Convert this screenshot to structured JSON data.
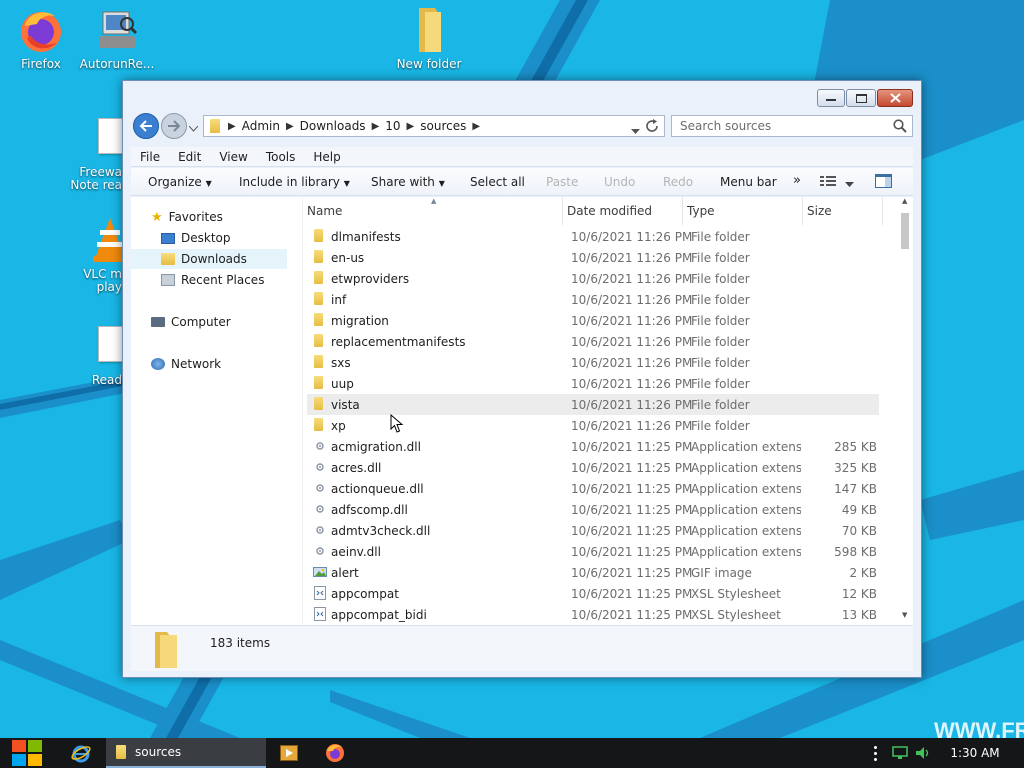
{
  "desktop": {
    "icons": [
      {
        "label": "Firefox"
      },
      {
        "label": "AutorunRe..."
      },
      {
        "label": "New folder"
      },
      {
        "label": "Freewa\nNote rea"
      },
      {
        "label": "VLC m\nplay"
      },
      {
        "label": "Read"
      }
    ],
    "watermark": "WWW.FR"
  },
  "window": {
    "address": {
      "breadcrumbs": [
        "Admin",
        "Downloads",
        "10",
        "sources"
      ]
    },
    "search": {
      "placeholder": "Search sources"
    },
    "menu": [
      "File",
      "Edit",
      "View",
      "Tools",
      "Help"
    ],
    "toolbar": {
      "organize": "Organize",
      "include_in_library": "Include in library",
      "share_with": "Share with",
      "select_all": "Select all",
      "paste": "Paste",
      "undo": "Undo",
      "redo": "Redo",
      "menu_bar": "Menu bar",
      "more": "»"
    },
    "nav": {
      "favorites": "Favorites",
      "desktop": "Desktop",
      "downloads": "Downloads",
      "recent_places": "Recent Places",
      "computer": "Computer",
      "network": "Network"
    },
    "columns": {
      "name": "Name",
      "date": "Date modified",
      "type": "Type",
      "size": "Size"
    },
    "files": [
      {
        "name": "dlmanifests",
        "date": "10/6/2021 11:26 PM",
        "type": "File folder",
        "size": "",
        "icon": "folder"
      },
      {
        "name": "en-us",
        "date": "10/6/2021 11:26 PM",
        "type": "File folder",
        "size": "",
        "icon": "folder"
      },
      {
        "name": "etwproviders",
        "date": "10/6/2021 11:26 PM",
        "type": "File folder",
        "size": "",
        "icon": "folder"
      },
      {
        "name": "inf",
        "date": "10/6/2021 11:26 PM",
        "type": "File folder",
        "size": "",
        "icon": "folder"
      },
      {
        "name": "migration",
        "date": "10/6/2021 11:26 PM",
        "type": "File folder",
        "size": "",
        "icon": "folder"
      },
      {
        "name": "replacementmanifests",
        "date": "10/6/2021 11:26 PM",
        "type": "File folder",
        "size": "",
        "icon": "folder"
      },
      {
        "name": "sxs",
        "date": "10/6/2021 11:26 PM",
        "type": "File folder",
        "size": "",
        "icon": "folder"
      },
      {
        "name": "uup",
        "date": "10/6/2021 11:26 PM",
        "type": "File folder",
        "size": "",
        "icon": "folder"
      },
      {
        "name": "vista",
        "date": "10/6/2021 11:26 PM",
        "type": "File folder",
        "size": "",
        "icon": "folder"
      },
      {
        "name": "xp",
        "date": "10/6/2021 11:26 PM",
        "type": "File folder",
        "size": "",
        "icon": "folder"
      },
      {
        "name": "acmigration.dll",
        "date": "10/6/2021 11:25 PM",
        "type": "Application extens...",
        "size": "285 KB",
        "icon": "dll"
      },
      {
        "name": "acres.dll",
        "date": "10/6/2021 11:25 PM",
        "type": "Application extens...",
        "size": "325 KB",
        "icon": "dll"
      },
      {
        "name": "actionqueue.dll",
        "date": "10/6/2021 11:25 PM",
        "type": "Application extens...",
        "size": "147 KB",
        "icon": "dll"
      },
      {
        "name": "adfscomp.dll",
        "date": "10/6/2021 11:25 PM",
        "type": "Application extens...",
        "size": "49 KB",
        "icon": "dll"
      },
      {
        "name": "admtv3check.dll",
        "date": "10/6/2021 11:25 PM",
        "type": "Application extens...",
        "size": "70 KB",
        "icon": "dll"
      },
      {
        "name": "aeinv.dll",
        "date": "10/6/2021 11:25 PM",
        "type": "Application extens...",
        "size": "598 KB",
        "icon": "dll"
      },
      {
        "name": "alert",
        "date": "10/6/2021 11:25 PM",
        "type": "GIF image",
        "size": "2 KB",
        "icon": "image"
      },
      {
        "name": "appcompat",
        "date": "10/6/2021 11:25 PM",
        "type": "XSL Stylesheet",
        "size": "12 KB",
        "icon": "xsl"
      },
      {
        "name": "appcompat_bidi",
        "date": "10/6/2021 11:25 PM",
        "type": "XSL Stylesheet",
        "size": "13 KB",
        "icon": "xsl"
      }
    ],
    "hovered_row": "vista",
    "status": {
      "item_count": "183 items"
    }
  },
  "taskbar": {
    "active_window": "sources",
    "clock": "1:30 AM"
  }
}
